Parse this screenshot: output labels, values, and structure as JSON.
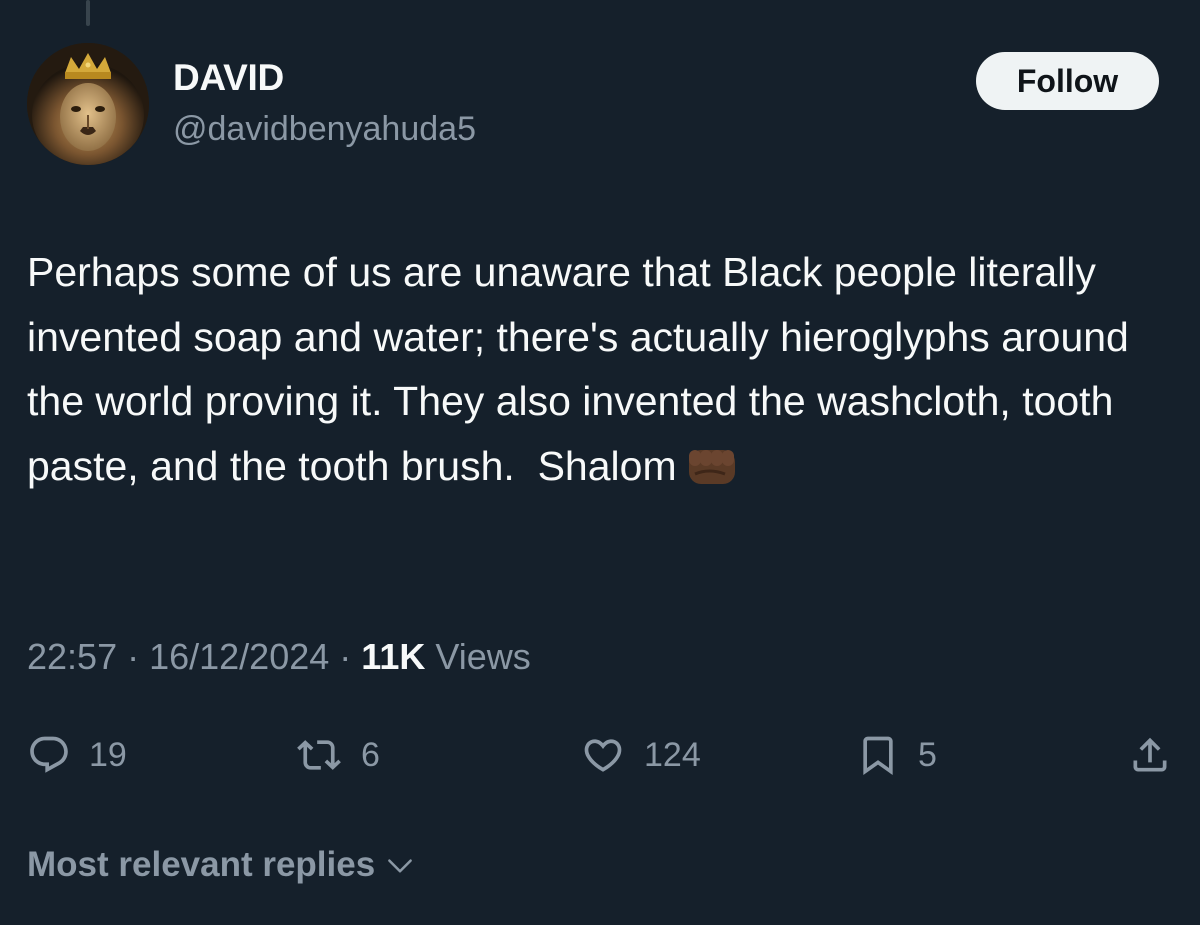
{
  "author": {
    "display_name": "DAVID",
    "handle": "@davidbenyahuda5",
    "avatar_icon": "lion-with-crown-avatar"
  },
  "follow_button": {
    "label": "Follow"
  },
  "tweet": {
    "text": "Perhaps some of us are unaware that Black people literally invented soap and water; there's actually hieroglyphs around the world proving it. They also invented the washcloth, tooth paste, and the tooth brush.  Shalom",
    "emoji_icon": "raised-fist-dark-skin-tone-icon"
  },
  "meta": {
    "time": "22:57",
    "separator1": " · ",
    "date": "16/12/2024",
    "separator2": " · ",
    "views_count": "11K",
    "views_label": " Views"
  },
  "actions": {
    "replies": {
      "icon": "reply-icon",
      "count": "19"
    },
    "reposts": {
      "icon": "repost-icon",
      "count": "6"
    },
    "likes": {
      "icon": "heart-icon",
      "count": "124"
    },
    "bookmarks": {
      "icon": "bookmark-icon",
      "count": "5"
    },
    "share": {
      "icon": "share-icon"
    }
  },
  "replies_sort": {
    "label": "Most relevant replies",
    "icon": "chevron-down-icon"
  },
  "colors": {
    "background": "#15202b",
    "primary_text": "#f7f9f9",
    "secondary_text": "#8b98a5",
    "follow_button_bg": "#eff3f4"
  }
}
